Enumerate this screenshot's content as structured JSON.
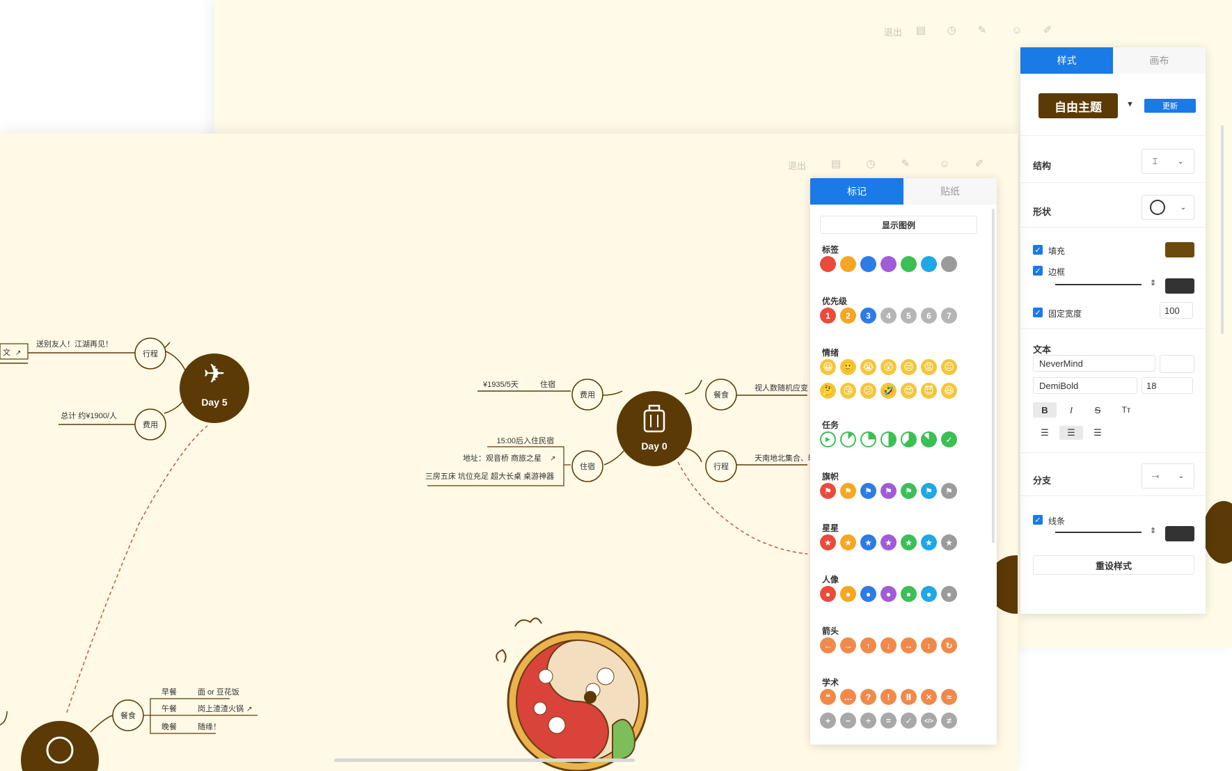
{
  "back_toolbar": {
    "exit_label": "退出"
  },
  "front_toolbar": {
    "exit_label": "退出"
  },
  "style_panel": {
    "tabs": [
      {
        "label": "样式"
      },
      {
        "label": "画布"
      }
    ],
    "theme_label": "自由主题",
    "update_label": "更新",
    "structure_label": "结构",
    "shape_label": "形状",
    "fill_label": "填充",
    "border_label": "边框",
    "fixed_width_label": "固定宽度",
    "fixed_width_value": "100",
    "text_label": "文本",
    "font_family": "NeverMind",
    "font_weight": "DemiBold",
    "font_size": "18",
    "bold_label": "B",
    "italic_label": "I",
    "strike_label": "S",
    "case_label": "Tт",
    "branch_label": "分支",
    "line_label": "线条",
    "reset_label": "重设样式",
    "colors": {
      "fill": "#6b4a0c",
      "border": "#333333",
      "line": "#333333",
      "accent": "#1a7ae6",
      "theme_bg": "#5b3a06"
    }
  },
  "marker_panel": {
    "tabs": [
      {
        "label": "标记"
      },
      {
        "label": "贴纸"
      }
    ],
    "show_legend_label": "显示图例",
    "sections": {
      "tag": {
        "title": "标签",
        "colors": [
          "#e94b3c",
          "#f5a623",
          "#2d7be5",
          "#a05cd6",
          "#3cbf55",
          "#1fa7e6",
          "#9b9b9b"
        ]
      },
      "priority": {
        "title": "优先级",
        "labels": [
          "1",
          "2",
          "3",
          "4",
          "5",
          "6",
          "7"
        ],
        "colors": [
          "#e94b3c",
          "#f5a623",
          "#2d7be5",
          "#b5b5b5",
          "#b5b5b5",
          "#b5b5b5",
          "#b5b5b5"
        ]
      },
      "mood": {
        "title": "情绪",
        "row1": [
          "😀",
          "🙂",
          "😭",
          "😲",
          "😒",
          "😡",
          "😐"
        ],
        "row2": [
          "🤔",
          "😘",
          "😕",
          "🤣",
          "😍",
          "😈",
          "😆"
        ]
      },
      "task": {
        "title": "任务"
      },
      "flag": {
        "title": "旗帜"
      },
      "star": {
        "title": "星星"
      },
      "person": {
        "title": "人像"
      },
      "arrow": {
        "title": "箭头",
        "glyphs": [
          "←",
          "→",
          "↑",
          "↓",
          "↔",
          "↕",
          "↻"
        ]
      },
      "academic": {
        "title": "学术",
        "row1": [
          "❝",
          "…",
          "?",
          "!",
          "Ⅱ",
          "✕",
          "≈"
        ],
        "row2": [
          "+",
          "−",
          "÷",
          "=",
          "✓",
          "</>",
          "≠"
        ]
      }
    }
  },
  "mindmap": {
    "day5": {
      "title": "Day 5",
      "branch_trip": "行程",
      "branch_cost": "费用",
      "trip_text": "送别友人！江湖再见！",
      "cost_text": "总计 约¥1900/人",
      "left_fragment": "文"
    },
    "day0": {
      "title": "Day 0",
      "branch_cost": "费用",
      "branch_stay": "住宿",
      "branch_food": "餐食",
      "branch_trip": "行程",
      "cost_amount": "¥1935/5天",
      "cost_sub": "住宿",
      "stay_line1": "15:00后入住民宿",
      "stay_line2": "地址：观音桥 商旅之星",
      "stay_line3": "三房五床 坑位充足 超大长桌 桌游神器",
      "food_text": "视人数随机应变",
      "trip_text": "天南地北集合、晚"
    },
    "meals": {
      "branch": "餐食",
      "breakfast": "早餐",
      "breakfast_val": "面 or 豆花饭",
      "lunch": "午餐",
      "lunch_val": "岗上渣渣火锅",
      "dinner": "晚餐",
      "dinner_val": "随缘！"
    }
  }
}
